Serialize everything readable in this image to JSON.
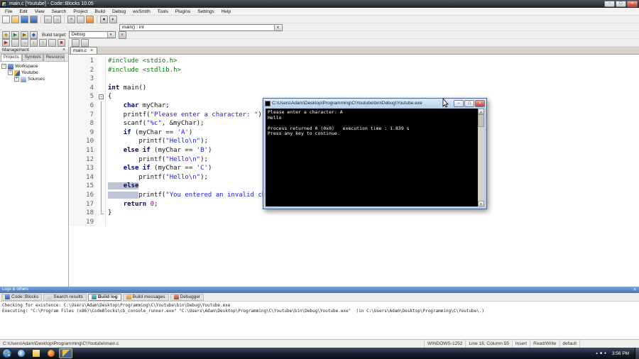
{
  "window": {
    "title": "main.c [Youtube] - Code::Blocks 10.05",
    "controls": [
      {
        "name": "minimize-button",
        "g": "−"
      },
      {
        "name": "maximize-button",
        "g": "□"
      },
      {
        "name": "close-button",
        "g": "×"
      }
    ]
  },
  "menubar": {
    "items": [
      "File",
      "Edit",
      "View",
      "Search",
      "Project",
      "Build",
      "Debug",
      "wxSmith",
      "Tools",
      "Plugins",
      "Settings",
      "Help"
    ]
  },
  "toolbars": {
    "main_icons": [
      {
        "name": "new-file-icon",
        "col": "white"
      },
      {
        "name": "open-file-icon",
        "col": "yellow"
      },
      {
        "name": "save-icon",
        "col": "blue"
      },
      {
        "name": "save-all-icon",
        "col": "blue"
      },
      {
        "sep": true
      },
      {
        "name": "undo-icon",
        "col": "gray",
        "g": "←",
        "fg": "#2a7a2a"
      },
      {
        "name": "redo-icon",
        "col": "gray",
        "g": "→",
        "fg": "#2a7a2a"
      },
      {
        "sep": true
      },
      {
        "name": "cut-icon",
        "col": "gray",
        "g": "×",
        "fg": "#555555"
      },
      {
        "name": "copy-icon",
        "col": "gray"
      },
      {
        "name": "paste-icon",
        "col": "orange"
      },
      {
        "sep": true
      },
      {
        "name": "find-icon",
        "col": "gray",
        "g": "●",
        "fg": "#333333"
      },
      {
        "name": "replace-icon",
        "col": "gray",
        "g": "◐",
        "fg": "#333333"
      }
    ],
    "symbol_combo_value": "main() : int",
    "compiler_icons": [
      {
        "name": "build-icon",
        "col": "gray",
        "g": "◆",
        "fg": "#c89a10"
      },
      {
        "name": "run-icon",
        "col": "gray",
        "g": "▶",
        "fg": "#2a8a2a"
      },
      {
        "name": "build-and-run-icon",
        "col": "gray",
        "g": "▶",
        "fg": "#8a6a00"
      },
      {
        "name": "rebuild-icon",
        "col": "gray",
        "g": "◆",
        "fg": "#2a5aa8"
      }
    ],
    "build_target_label": "Build target:",
    "build_target_value": "Debug",
    "abort_icon": {
      "name": "abort-icon",
      "col": "gray",
      "g": "×",
      "fg": "#c03020"
    },
    "debugger_icons": [
      {
        "name": "debug-continue-icon",
        "col": "gray",
        "g": "▶",
        "fg": "#b03020"
      },
      {
        "name": "run-to-cursor-icon",
        "col": "gray"
      },
      {
        "name": "next-line-icon",
        "col": "gray",
        "g": "→",
        "fg": "#555555"
      },
      {
        "name": "step-into-icon",
        "col": "gray",
        "g": "↓",
        "fg": "#555555"
      },
      {
        "name": "step-out-icon",
        "col": "gray",
        "g": "↑",
        "fg": "#555555"
      },
      {
        "name": "next-instruction-icon",
        "col": "gray"
      },
      {
        "name": "stop-debugger-icon",
        "col": "gray",
        "g": "■",
        "fg": "#b03020"
      },
      {
        "sep": true
      },
      {
        "name": "debugging-windows-icon",
        "col": "gray"
      },
      {
        "name": "debugger-info-icon",
        "col": "gray"
      }
    ]
  },
  "management": {
    "title": "Management",
    "tabs": [
      {
        "label": "Projects",
        "active": true
      },
      {
        "label": "Symbols",
        "active": false
      },
      {
        "label": "Resources",
        "active": false
      }
    ],
    "tree": [
      {
        "label": "Workspace",
        "depth": 0,
        "expander": "minus",
        "icon": "workspace-icon"
      },
      {
        "label": "Youtube",
        "depth": 1,
        "expander": "minus",
        "icon": "project-icon"
      },
      {
        "label": "Sources",
        "depth": 2,
        "expander": "plus",
        "icon": "folder-icon"
      }
    ]
  },
  "editor": {
    "tab_label": "main.c",
    "lines": [
      {
        "n": 1,
        "tk": [
          {
            "t": "#include <stdio.h>",
            "c": "pp"
          }
        ]
      },
      {
        "n": 2,
        "tk": [
          {
            "t": "#include <stdlib.h>",
            "c": "pp"
          }
        ]
      },
      {
        "n": 3,
        "tk": []
      },
      {
        "n": 4,
        "tk": [
          {
            "t": "int",
            "c": "kw"
          },
          {
            "t": " main()",
            "c": "pl"
          }
        ]
      },
      {
        "n": 5,
        "fold": "box",
        "tk": [
          {
            "t": "{",
            "c": "pl"
          }
        ]
      },
      {
        "n": 6,
        "fold": "mid",
        "tk": [
          {
            "t": "    ",
            "c": "pl"
          },
          {
            "t": "char",
            "c": "kw"
          },
          {
            "t": " myChar;",
            "c": "pl"
          }
        ]
      },
      {
        "n": 7,
        "fold": "mid",
        "tk": [
          {
            "t": "    printf(",
            "c": "pl"
          },
          {
            "t": "\"Please enter a character: \"",
            "c": "str"
          },
          {
            "t": ");",
            "c": "pl"
          }
        ]
      },
      {
        "n": 8,
        "fold": "mid",
        "tk": [
          {
            "t": "    scanf(",
            "c": "pl"
          },
          {
            "t": "\"%c\"",
            "c": "str"
          },
          {
            "t": ", &myChar);",
            "c": "pl"
          }
        ]
      },
      {
        "n": 9,
        "fold": "mid",
        "tk": [
          {
            "t": "    ",
            "c": "pl"
          },
          {
            "t": "if",
            "c": "kw"
          },
          {
            "t": " (myChar == ",
            "c": "pl"
          },
          {
            "t": "'A'",
            "c": "chr"
          },
          {
            "t": ")",
            "c": "pl"
          }
        ]
      },
      {
        "n": 10,
        "fold": "mid",
        "tk": [
          {
            "t": "        printf(",
            "c": "pl"
          },
          {
            "t": "\"Hello\\n\"",
            "c": "str"
          },
          {
            "t": ");",
            "c": "pl"
          }
        ]
      },
      {
        "n": 11,
        "fold": "mid",
        "tk": [
          {
            "t": "    ",
            "c": "pl"
          },
          {
            "t": "else",
            "c": "kw"
          },
          {
            "t": " ",
            "c": "pl"
          },
          {
            "t": "if",
            "c": "kw"
          },
          {
            "t": " (myChar == ",
            "c": "pl"
          },
          {
            "t": "'B'",
            "c": "chr"
          },
          {
            "t": ")",
            "c": "pl"
          }
        ]
      },
      {
        "n": 12,
        "fold": "mid",
        "tk": [
          {
            "t": "        printf(",
            "c": "pl"
          },
          {
            "t": "\"Hello\\n\"",
            "c": "str"
          },
          {
            "t": ");",
            "c": "pl"
          }
        ]
      },
      {
        "n": 13,
        "fold": "mid",
        "tk": [
          {
            "t": "    ",
            "c": "pl"
          },
          {
            "t": "else",
            "c": "kw"
          },
          {
            "t": " ",
            "c": "pl"
          },
          {
            "t": "if",
            "c": "kw"
          },
          {
            "t": " (myChar == ",
            "c": "pl"
          },
          {
            "t": "'C'",
            "c": "chr"
          },
          {
            "t": ")",
            "c": "pl"
          }
        ]
      },
      {
        "n": 14,
        "fold": "mid",
        "tk": [
          {
            "t": "        printf(",
            "c": "pl"
          },
          {
            "t": "\"Hello\\n\"",
            "c": "str"
          },
          {
            "t": ");",
            "c": "pl"
          }
        ]
      },
      {
        "n": 15,
        "fold": "mid",
        "tk": [
          {
            "t": "    ",
            "c": "pl sel"
          },
          {
            "t": "else",
            "c": "kw sel"
          }
        ]
      },
      {
        "n": 16,
        "fold": "mid",
        "tk": [
          {
            "t": "        ",
            "c": "pl sel"
          },
          {
            "t": "printf(",
            "c": "pl"
          },
          {
            "t": "\"You entered an invalid character.\\n\"",
            "c": "str"
          },
          {
            "t": ");",
            "c": "pl"
          }
        ]
      },
      {
        "n": 17,
        "fold": "mid",
        "tk": [
          {
            "t": "    ",
            "c": "pl"
          },
          {
            "t": "return",
            "c": "kw"
          },
          {
            "t": " ",
            "c": "pl"
          },
          {
            "t": "0",
            "c": "num"
          },
          {
            "t": ";",
            "c": "pl"
          }
        ]
      },
      {
        "n": 18,
        "fold": "end",
        "tk": [
          {
            "t": "}",
            "c": "pl"
          }
        ]
      },
      {
        "n": 19,
        "tk": []
      }
    ]
  },
  "console": {
    "title": "C:\\Users\\Adam\\Desktop\\Programming\\C\\Youtube\\bin\\Debug\\Youtube.exe",
    "controls": [
      {
        "name": "console-minimize-button",
        "g": "−"
      },
      {
        "name": "console-maximize-button",
        "g": "□"
      },
      {
        "name": "console-close-button",
        "g": "×",
        "col": "red"
      }
    ],
    "lines": [
      "Please enter a character: A",
      "Hello",
      "",
      "Process returned 0 (0x0)   execution time : 1.839 s",
      "Press any key to continue."
    ]
  },
  "logs": {
    "title": "Logs & others",
    "tabs": [
      {
        "label": "Code::Blocks",
        "icon": "codeblocks-log-icon",
        "col": "blue",
        "active": false
      },
      {
        "label": "Search results",
        "icon": "search-results-icon",
        "col": "gray",
        "active": false
      },
      {
        "label": "Build log",
        "icon": "build-log-icon",
        "col": "teal",
        "active": true
      },
      {
        "label": "Build messages",
        "icon": "build-messages-icon",
        "col": "orange",
        "active": false
      },
      {
        "label": "Debugger",
        "icon": "debugger-icon",
        "col": "red",
        "active": false
      }
    ],
    "lines": [
      "Checking for existence: C:\\Users\\Adam\\Desktop\\Programming\\C\\Youtube\\bin\\Debug\\Youtube.exe",
      "Executing: \"C:\\Program Files (x86)\\CodeBlocks\\cb_console_runner.exe\" \"C:\\Users\\Adam\\Desktop\\Programming\\C\\Youtube\\bin\\Debug\\Youtube.exe\"  (in C:\\Users\\Adam\\Desktop\\Programming\\C\\Youtube\\.)"
    ]
  },
  "statusbar": {
    "fields": [
      {
        "name": "file-path",
        "text": "C:\\Users\\Adam\\Desktop\\Programming\\C\\Youtube\\main.c"
      },
      {
        "name": "encoding",
        "text": "WINDOWS-1252"
      },
      {
        "name": "cursor-position",
        "text": "Line 16, Column 55"
      },
      {
        "name": "insert-mode",
        "text": "Insert"
      },
      {
        "name": "readwrite-state",
        "text": "Read/Write"
      },
      {
        "name": "profile",
        "text": "default"
      }
    ]
  },
  "taskbar": {
    "apps": [
      {
        "name": "internet-explorer-icon",
        "col": "ie",
        "g": "e",
        "active": false
      },
      {
        "name": "explorer-icon",
        "col": "folder",
        "active": false
      },
      {
        "name": "media-player-icon",
        "col": "wmp",
        "active": false
      },
      {
        "name": "codeblocks-icon",
        "col": "cb",
        "active": true
      }
    ],
    "tray_icons": [
      {
        "name": "show-hidden-icons",
        "g": "▴"
      },
      {
        "name": "network-icon",
        "g": "■"
      },
      {
        "name": "volume-icon",
        "g": "●"
      }
    ],
    "time": "3:56 PM"
  }
}
